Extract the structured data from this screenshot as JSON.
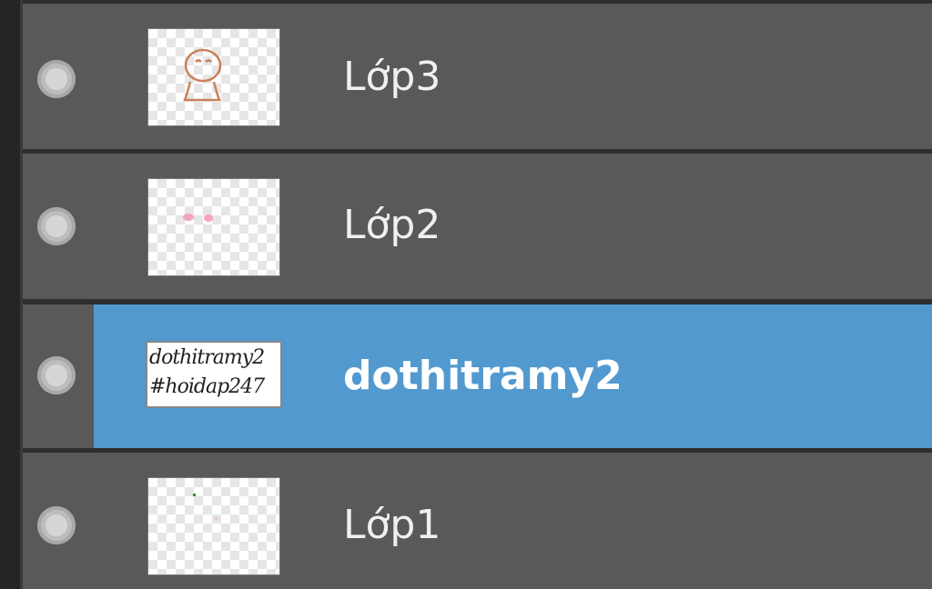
{
  "layers_panel": {
    "layers": [
      {
        "name": "Lớp3",
        "thumbnail": "figure-sketch",
        "selected": false
      },
      {
        "name": "Lớp2",
        "thumbnail": "pink-dots",
        "selected": false
      },
      {
        "name": "dothitramy2",
        "thumbnail": "text-signature",
        "thumb_line1": "dothitramy2",
        "thumb_line2": "#hoidap247",
        "selected": true
      },
      {
        "name": "Lớp1",
        "thumbnail": "faint-marks",
        "selected": false
      }
    ],
    "colors": {
      "row": "#595959",
      "selected_row": "#5299cf",
      "text": "#f0f0f0"
    }
  }
}
